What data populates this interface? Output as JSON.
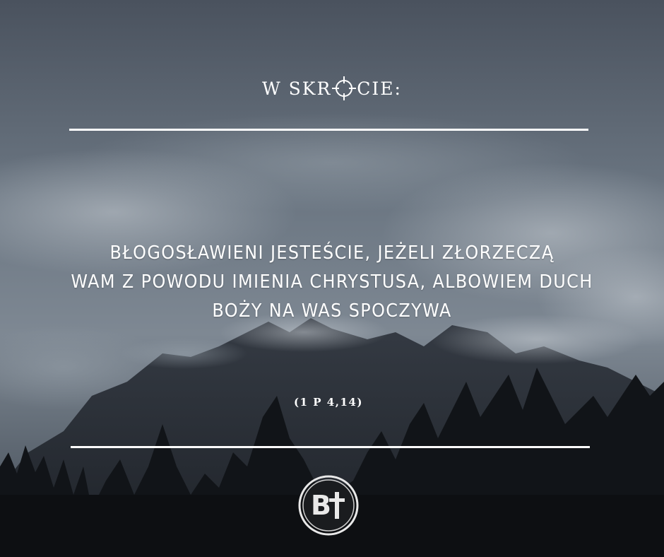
{
  "header": {
    "title_before": "W SKR",
    "title_after": "CIE:",
    "crosshair_icon": "crosshair-icon"
  },
  "quote": {
    "lines": [
      "BŁOGOSŁAWIENI JESTEŚCIE, JEŻELI ZŁORZECZĄ",
      "WAM Z POWODU IMIENIA CHRYSTUSA, ALBOWIEM DUCH",
      "BOŻY NA WAS SPOCZYWA"
    ]
  },
  "reference": "(1 P 4,14)",
  "logo": {
    "text": "B",
    "icon": "cross-icon"
  },
  "colors": {
    "text": "#ffffff",
    "sky_top": "#4b5563",
    "sky_mid": "#7f8c9a",
    "mountain": "#2a2f36",
    "trees": "#0f1215"
  }
}
